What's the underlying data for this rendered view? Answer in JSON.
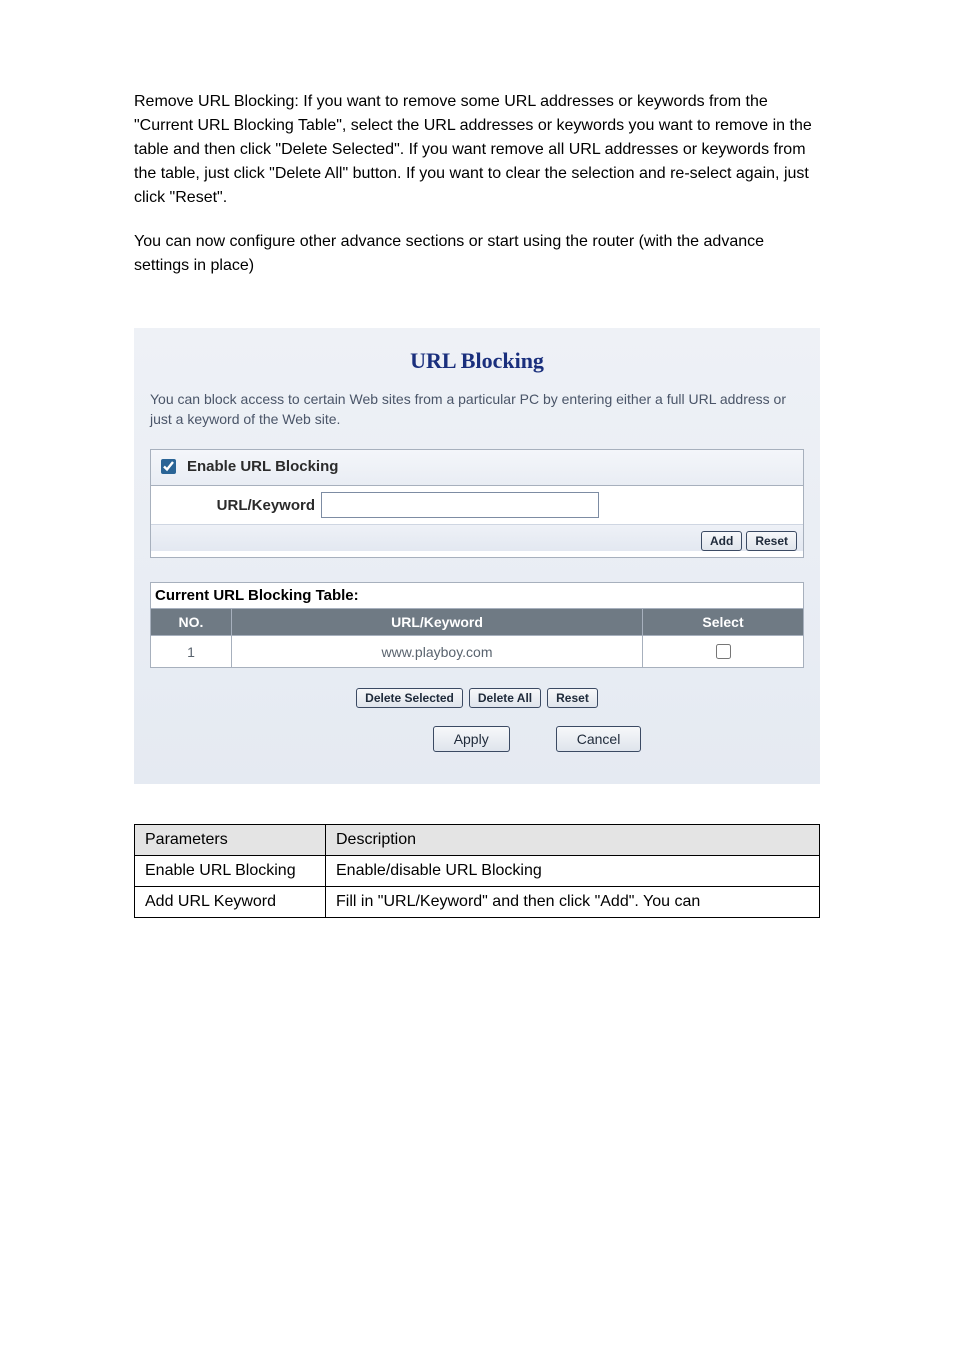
{
  "intro": {
    "p1": "Remove URL Blocking: If you want to remove some URL addresses or keywords from the \"Current URL Blocking Table\", select the URL addresses or keywords you want to remove in the table and then click \"Delete Selected\". If you want remove all URL addresses or keywords from the table, just click \"Delete All\" button. If you want to clear the selection and re-select again, just click \"Reset\".",
    "p2": "You can now configure other advance sections or start using the router (with the advance settings in place)"
  },
  "panel": {
    "title": "URL Blocking",
    "description": "You can block access to certain Web sites from a particular PC by entering either a full URL address or just a keyword of the Web site.",
    "enable_label": "Enable URL Blocking",
    "enable_checked": true,
    "url_keyword_label": "URL/Keyword",
    "url_keyword_value": "",
    "buttons": {
      "add": "Add",
      "reset": "Reset",
      "delete_selected": "Delete Selected",
      "delete_all": "Delete All",
      "apply": "Apply",
      "cancel": "Cancel"
    },
    "table": {
      "caption": "Current URL Blocking Table:",
      "headers": {
        "no": "NO.",
        "kw": "URL/Keyword",
        "select": "Select"
      },
      "rows": [
        {
          "no": "1",
          "kw": "www.playboy.com",
          "selected": false
        }
      ]
    }
  },
  "desc_table": {
    "head": {
      "c1": "Parameters",
      "c2": "Description"
    },
    "rows": [
      {
        "c1": "Enable URL Blocking",
        "c2": "Enable/disable URL Blocking"
      },
      {
        "c1": "Add URL Keyword",
        "c2": "Fill in \"URL/Keyword\" and then click \"Add\". You can"
      }
    ]
  }
}
